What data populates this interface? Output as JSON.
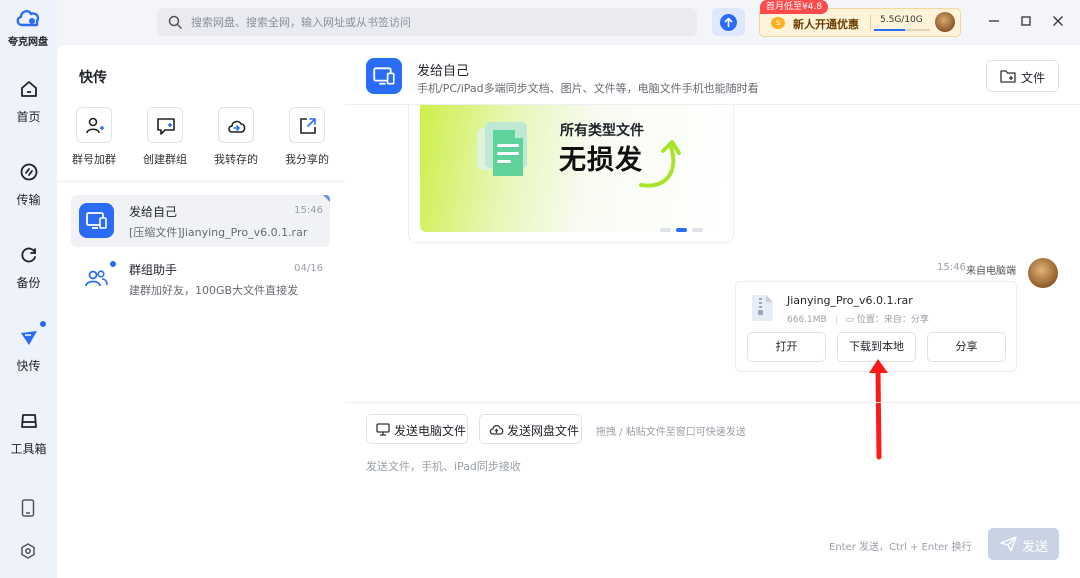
{
  "app": {
    "name": "夸克网盘"
  },
  "nav": {
    "items": [
      {
        "label": "首页",
        "icon": "home-icon"
      },
      {
        "label": "传输",
        "icon": "transfer-icon"
      },
      {
        "label": "备份",
        "icon": "backup-icon"
      },
      {
        "label": "快传",
        "icon": "quick-send-icon",
        "active": true,
        "badge": true
      },
      {
        "label": "工具箱",
        "icon": "toolbox-icon"
      }
    ],
    "bottom": [
      {
        "icon": "phone-icon"
      },
      {
        "icon": "settings-icon"
      }
    ]
  },
  "topbar": {
    "search_placeholder": "搜索网盘、搜索全网，输入网址或从书签访问",
    "promo": {
      "tag": "首月低至¥4.8",
      "coin": "S",
      "text": "新人开通优惠",
      "storage": "5.5G/10G",
      "storage_fraction": 0.55
    }
  },
  "panel": {
    "title": "快传",
    "quick_actions": [
      {
        "label": "群号加群",
        "icon": "add-person-icon"
      },
      {
        "label": "创建群组",
        "icon": "create-group-icon"
      },
      {
        "label": "我转存的",
        "icon": "cloud-saved-icon"
      },
      {
        "label": "我分享的",
        "icon": "share-out-icon"
      }
    ],
    "conversations": [
      {
        "name": "发给自己",
        "preview": "[压缩文件]Jianying_Pro_v6.0.1.rar",
        "time": "15:46",
        "selected": true
      },
      {
        "name": "群组助手",
        "preview": "建群加好友，100GB大文件直接发",
        "time": "04/16",
        "unread": true
      }
    ]
  },
  "chat": {
    "title": "发给自己",
    "subtitle": "手机/PC/iPad多端同步文档、图片、文件等，电脑文件手机也能随时看",
    "file_button": "文件",
    "banner": {
      "line1": "所有类型文件",
      "line2": "无损发"
    },
    "message": {
      "time": "15:46",
      "source": "来自电脑端",
      "file_name": "Jianying_Pro_v6.0.1.rar",
      "size": "666.1MB",
      "location_label": "位置：来自：分享",
      "actions": {
        "open": "打开",
        "download": "下载到本地",
        "share": "分享"
      }
    }
  },
  "composer": {
    "send_pc_file": "发送电脑文件",
    "send_cloud_file": "发送网盘文件",
    "drag_hint": "拖拽 / 粘贴文件至窗口可快速发送",
    "placeholder": "发送文件，手机、iPad同步接收",
    "shortcut_hint": "Enter 发送，Ctrl + Enter 换行",
    "send": "发送"
  },
  "colors": {
    "accent": "#2a6cf6",
    "annotation_arrow": "#ff1a1a"
  }
}
